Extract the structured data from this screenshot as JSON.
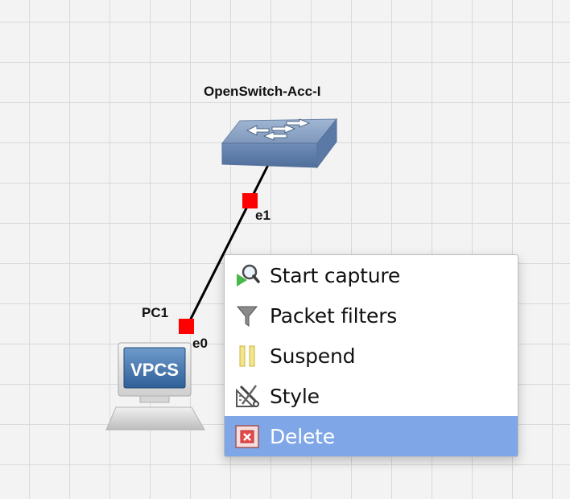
{
  "topology": {
    "nodes": [
      {
        "label": "OpenSwitch-Acc-I",
        "icon": "switch-icon"
      },
      {
        "label": "PC1",
        "icon": "vpcs-computer-icon",
        "icon_text": "VPCS"
      }
    ],
    "link": {
      "port_a": "e1",
      "port_b": "e0",
      "status_color": "#ff0000"
    }
  },
  "context_menu": {
    "items": [
      {
        "label": "Start capture",
        "icon": "start-capture-icon"
      },
      {
        "label": "Packet filters",
        "icon": "packet-filter-icon"
      },
      {
        "label": "Suspend",
        "icon": "suspend-icon"
      },
      {
        "label": "Style",
        "icon": "style-icon"
      },
      {
        "label": "Delete",
        "icon": "delete-icon",
        "highlighted": true
      }
    ],
    "highlight_color": "#7fa7e8"
  }
}
